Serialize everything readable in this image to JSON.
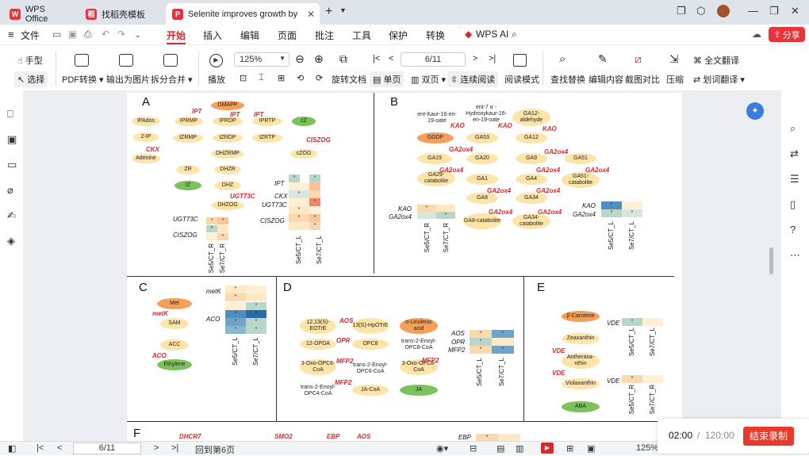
{
  "tabs": [
    {
      "label": "WPS Office"
    },
    {
      "label": "找稻壳模板"
    },
    {
      "label": "Selenite improves growth by"
    }
  ],
  "menu": [
    "文件",
    "开始",
    "插入",
    "编辑",
    "页面",
    "批注",
    "工具",
    "保护",
    "转换",
    "WPS AI"
  ],
  "share_label": "分享",
  "toolbar": {
    "hand": "手型",
    "select": "选择",
    "pdf_convert": "PDF转换",
    "export_image": "输出为图片",
    "split_merge": "拆分合并",
    "play": "播放",
    "zoom": "125%",
    "page_input": "6/11",
    "rotate": "旋转文档",
    "single": "单页",
    "double": "双页",
    "continuous": "连续阅读",
    "read_mode": "阅读模式",
    "find_replace": "查找替换",
    "edit_content": "编辑内容",
    "crop_compare": "截图对比",
    "compress": "压缩",
    "full_translate": "全文翻译",
    "word_translate": "划词翻译"
  },
  "panels": {
    "A": {
      "label": "A",
      "nodes": [
        "DMAPP",
        "IPAdos",
        "IPRMP",
        "IPRDP",
        "IPRTP",
        "cZ",
        "2-IP",
        "tZRMP",
        "tZRDP",
        "tZRTP",
        "cZOG",
        "Adenine",
        "DHZRMP",
        "ZR",
        "DHZR",
        "IZ",
        "DHZ",
        "DHZOG"
      ],
      "genes": [
        "IPT",
        "IPT",
        "IPT",
        "CKX",
        "CISZOG",
        "UGT73C"
      ],
      "hm_left_rows": [
        "UGT73C",
        "CISZOG"
      ],
      "hm_right_rows": [
        "IPT",
        "CKX",
        "UGT73C",
        "CISZOG"
      ],
      "cols_left": [
        "Se5/CT_R",
        "Se7/CT_R"
      ],
      "cols_right": [
        "Se5/CT_L",
        "Se7/CT_L"
      ]
    },
    "B": {
      "label": "B",
      "nodes": [
        "ent-Kaur-16-en-19-oate",
        "ent-7 α -Hydroxykaur-16-en-19-oate",
        "GA12-aldehyde",
        "GGDP",
        "GA53",
        "GA12",
        "GA19",
        "GA20",
        "GA9",
        "GA51",
        "GA29-catabolite",
        "GA1",
        "GA4",
        "GA51-catabolite",
        "GA8",
        "GA34",
        "GA8-catabolite",
        "GA34-catabolite"
      ],
      "genes": [
        "KAO",
        "KAO",
        "KAO",
        "GA2ox4"
      ],
      "hm_left_rows": [
        "KAO",
        "GA2ox4"
      ],
      "hm_right_rows": [
        "KAO",
        "GA2ox4"
      ],
      "cols_left": [
        "Se5/CT_R",
        "Se7/CT_R"
      ],
      "cols_right": [
        "Se5/CT_L",
        "Se7/CT_L"
      ]
    },
    "C": {
      "label": "C",
      "nodes": [
        "Met",
        "SAM",
        "ACC",
        "Ethylene"
      ],
      "genes": [
        "metK",
        "ACO"
      ],
      "hm_rows": [
        "metK",
        "ACO"
      ],
      "cols": [
        "Se5/CT_L",
        "Se7/CT_L"
      ]
    },
    "D": {
      "label": "D",
      "nodes": [
        "12,13(S)-EOTrE",
        "13(S)-HpOTrE",
        "α-Linolenic acid",
        "12-OPDA",
        "OPC8",
        "trans-2-Enoyl-OPC8-CoA",
        "3-Oxo-OPC6-CoA",
        "trans-2-Enoyl-OPC6-CoA",
        "3-Oxo-OPC8-CoA",
        "trans-2-Enoyl-OPC4-CoA",
        "JA-CoA",
        "JA"
      ],
      "genes": [
        "AOS",
        "OPR",
        "MFP2",
        "MFP2",
        "MFP2"
      ],
      "hm_rows": [
        "AOS",
        "OPR",
        "MFP2"
      ],
      "cols": [
        "Se5/CT_L",
        "Se7/CT_L"
      ]
    },
    "E": {
      "label": "E",
      "nodes": [
        "β-Carotene",
        "Zeaxanthin",
        "Antheraxa-nthin",
        "Violaxanthin",
        "ABA"
      ],
      "genes": [
        "VDE",
        "VDE"
      ],
      "hm_rows": [
        "VDE",
        "VDE"
      ],
      "cols_top": [
        "Se5/CT_L",
        "Se7/CT_L"
      ],
      "cols_bottom": [
        "Se5/CT_R",
        "Se7/CT_R"
      ]
    },
    "F": {
      "label": "F",
      "genes": [
        "DHCR7",
        "SMO2",
        "EBP",
        "AOS",
        "EBP"
      ]
    }
  },
  "status": {
    "page": "6/11",
    "back": "回到第6页",
    "zoom": "125%"
  },
  "recorder": {
    "time": "02:00",
    "total": "120:00",
    "stop": "结束录制"
  }
}
